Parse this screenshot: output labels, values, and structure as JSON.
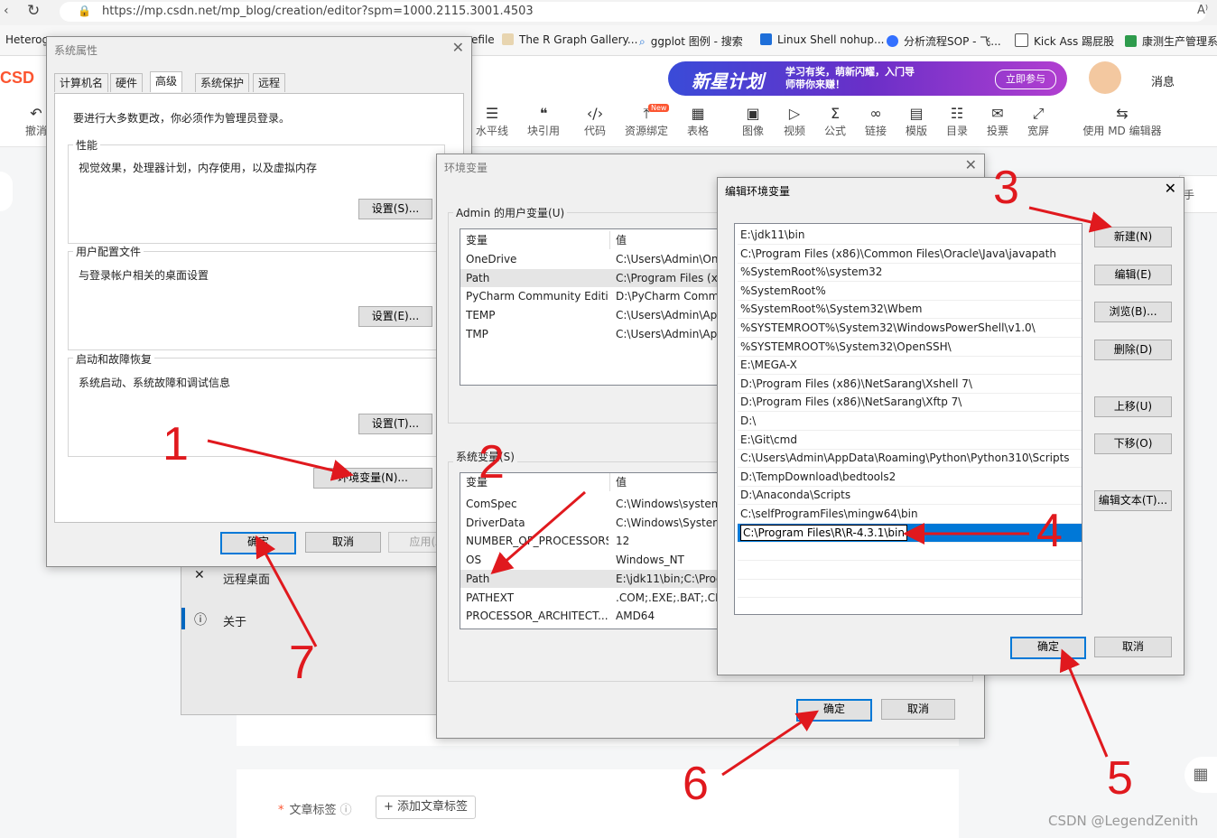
{
  "browser": {
    "url": "https://mp.csdn.net/mp_blog/creation/editor?spm=1000.2115.3001.4503",
    "reader_icon": "A⁾",
    "bookmarks": [
      "Heteroge",
      "efile",
      "The R Graph Gallery...",
      "ggplot 图例 - 搜索",
      "Linux Shell nohup...",
      "分析流程SOP - 飞...",
      "Kick Ass 踢屁股",
      "康测生产管理系"
    ]
  },
  "csdn": {
    "logo": "CSD",
    "banner_text": "新星计划",
    "banner_sub": "学习有奖，萌新闪耀，入门导师带你来赚！",
    "banner_btn": "立即参与",
    "messages": "消息",
    "undo": "撤消",
    "toolbar": [
      "水平线",
      "块引用",
      "代码",
      "资源绑定",
      "表格",
      "图像",
      "视频",
      "公式",
      "链接",
      "模版",
      "目录",
      "投票",
      "宽屏"
    ],
    "toolbar_icons": [
      "☰",
      "❝",
      "‹/›",
      "⤒",
      "▦",
      "▣",
      "▷",
      "Σ",
      "∞",
      "▤",
      "☷",
      "✉",
      "⤢"
    ],
    "new_badge": "New",
    "md_editor": "使用 MD 编辑器",
    "right_char": "手",
    "tags_label": "文章标签",
    "add_tag": "添加文章标签",
    "watermark": "CSDN @LegendZenith"
  },
  "settings_panel": {
    "remote_desktop": "远程桌面",
    "about": "关于"
  },
  "sysprops": {
    "title": "系统属性",
    "tabs": [
      "计算机名",
      "硬件",
      "高级",
      "系统保护",
      "远程"
    ],
    "admin_note": "要进行大多数更改，你必须作为管理员登录。",
    "perf_label": "性能",
    "perf_desc": "视觉效果，处理器计划，内存使用，以及虚拟内存",
    "perf_btn": "设置(S)...",
    "profile_label": "用户配置文件",
    "profile_desc": "与登录帐户相关的桌面设置",
    "profile_btn": "设置(E)...",
    "startup_label": "启动和故障恢复",
    "startup_desc": "系统启动、系统故障和调试信息",
    "startup_btn": "设置(T)...",
    "env_btn": "环境变量(N)...",
    "ok": "确定",
    "cancel": "取消",
    "apply": "应用(A"
  },
  "envvars": {
    "title": "环境变量",
    "user_group": "Admin 的用户变量(U)",
    "col_var": "变量",
    "col_val": "值",
    "user_vars": [
      {
        "name": "OneDrive",
        "value": "C:\\Users\\Admin\\One"
      },
      {
        "name": "Path",
        "value": "C:\\Program Files (x8"
      },
      {
        "name": "PyCharm Community Editi...",
        "value": "D:\\PyCharm Commu"
      },
      {
        "name": "TEMP",
        "value": "C:\\Users\\Admin\\App"
      },
      {
        "name": "TMP",
        "value": "C:\\Users\\Admin\\App"
      }
    ],
    "sys_group": "系统变量(S)",
    "sys_vars": [
      {
        "name": "ComSpec",
        "value": "C:\\Windows\\system"
      },
      {
        "name": "DriverData",
        "value": "C:\\Windows\\System"
      },
      {
        "name": "NUMBER_OF_PROCESSORS",
        "value": "12"
      },
      {
        "name": "OS",
        "value": "Windows_NT"
      },
      {
        "name": "Path",
        "value": "E:\\jdk11\\bin;C:\\Prog"
      },
      {
        "name": "PATHEXT",
        "value": ".COM;.EXE;.BAT;.CM"
      },
      {
        "name": "PROCESSOR_ARCHITECT...",
        "value": "AMD64"
      }
    ],
    "ok": "确定",
    "cancel": "取消"
  },
  "editenv": {
    "title": "编辑环境变量",
    "entries": [
      "E:\\jdk11\\bin",
      "C:\\Program Files (x86)\\Common Files\\Oracle\\Java\\javapath",
      "%SystemRoot%\\system32",
      "%SystemRoot%",
      "%SystemRoot%\\System32\\Wbem",
      "%SYSTEMROOT%\\System32\\WindowsPowerShell\\v1.0\\",
      "%SYSTEMROOT%\\System32\\OpenSSH\\",
      "E:\\MEGA-X",
      "D:\\Program Files (x86)\\NetSarang\\Xshell 7\\",
      "D:\\Program Files (x86)\\NetSarang\\Xftp 7\\",
      "D:\\",
      "E:\\Git\\cmd",
      "C:\\Users\\Admin\\AppData\\Roaming\\Python\\Python310\\Scripts",
      "D:\\TempDownload\\bedtools2",
      "D:\\Anaconda\\Scripts",
      "C:\\selfProgramFiles\\mingw64\\bin"
    ],
    "editing_value": "C:\\Program Files\\R\\R-4.3.1\\bin",
    "buttons": {
      "new": "新建(N)",
      "edit": "编辑(E)",
      "browse": "浏览(B)...",
      "delete": "删除(D)",
      "up": "上移(U)",
      "down": "下移(O)",
      "edit_text": "编辑文本(T)...",
      "ok": "确定",
      "cancel": "取消"
    }
  },
  "annotations": [
    "1",
    "2",
    "3",
    "4",
    "5",
    "6",
    "7"
  ],
  "colors": {
    "annotation": "#e0191e",
    "selection": "#0078d7",
    "csdn_red": "#fc5531"
  }
}
